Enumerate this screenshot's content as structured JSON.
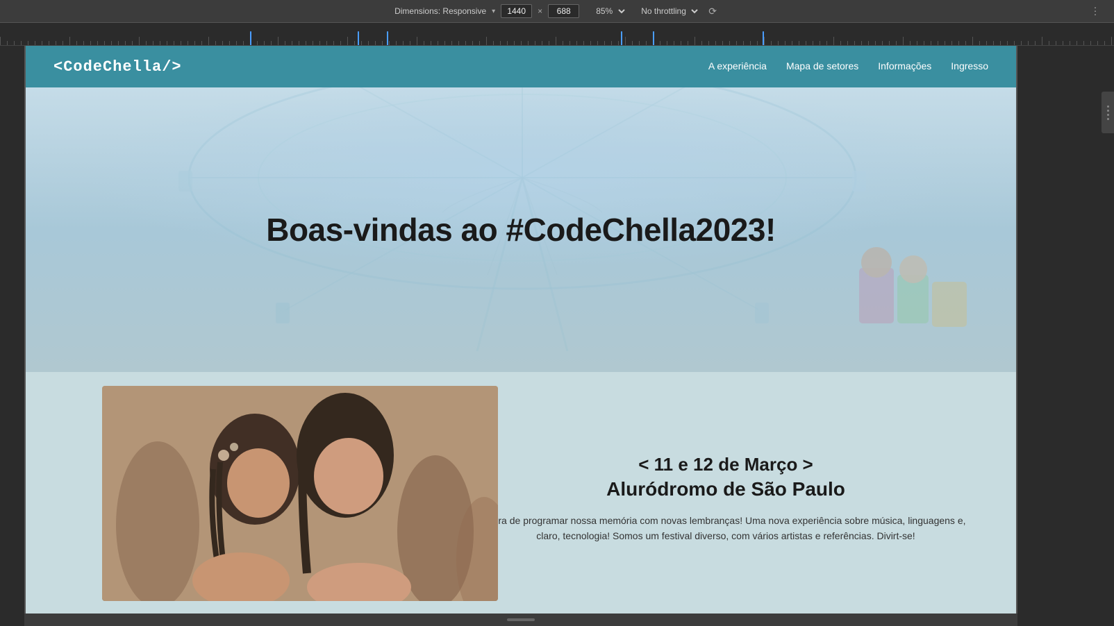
{
  "devtools": {
    "dimensions_label": "Dimensions: Responsive",
    "width_value": "1440",
    "height_value": "688",
    "separator": "×",
    "zoom_label": "85%",
    "throttle_label": "No throttling",
    "more_icon": "⋮"
  },
  "nav": {
    "logo": "<CodeChella/>",
    "links": [
      {
        "label": "A experiência"
      },
      {
        "label": "Mapa de setores"
      },
      {
        "label": "Informações"
      },
      {
        "label": "Ingresso"
      }
    ]
  },
  "hero": {
    "title": "Boas-vindas ao #CodeChella2023!"
  },
  "event": {
    "date": "< 11 e 12 de Março >",
    "venue": "Aluródromo de São Paulo",
    "description": "Hora de programar nossa memória com novas lembranças! Uma nova experiência sobre música, linguagens e, claro, tecnologia! Somos um festival diverso, com vários artistas e referências. Divirt-se!"
  },
  "bottom": {
    "scroll_hint": "≡"
  }
}
